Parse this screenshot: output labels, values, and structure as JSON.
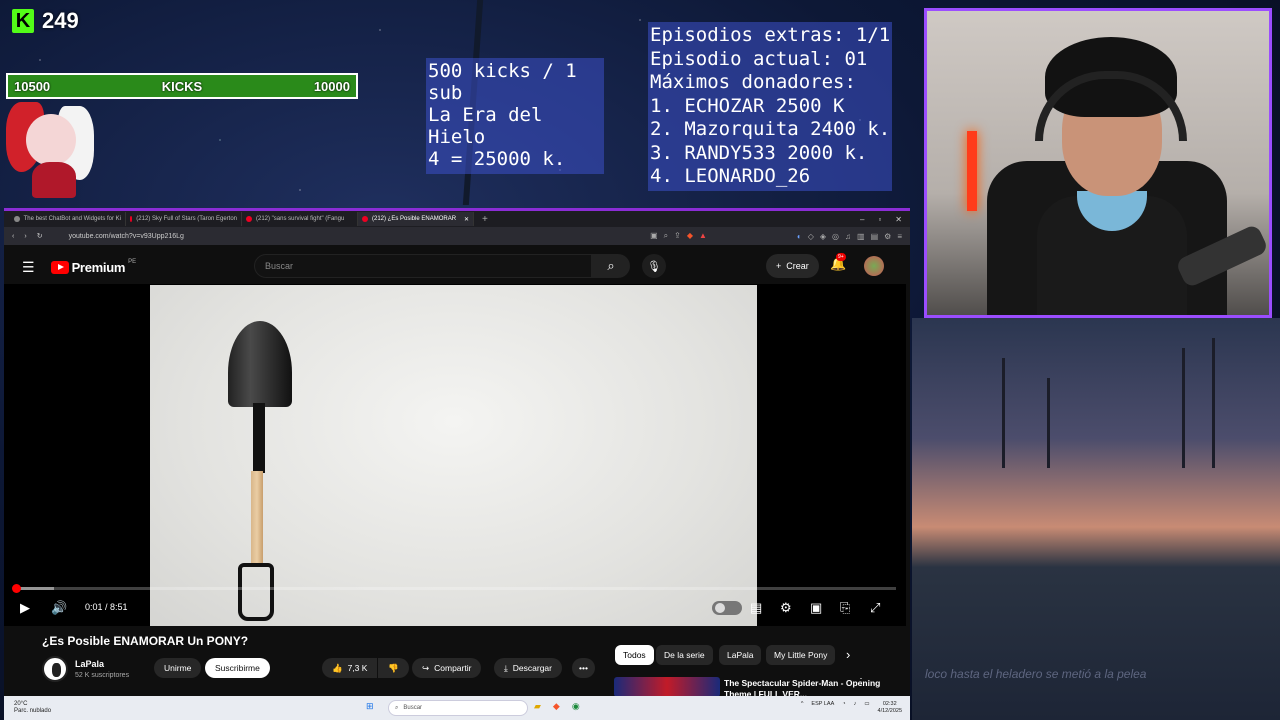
{
  "overlay": {
    "kick_count": "249",
    "kick_logo": "K",
    "kickbar": {
      "left": "10500",
      "label": "KICKS",
      "right": "10000"
    },
    "goal_lines": [
      "500 kicks / 1 sub",
      "La Era del Hielo",
      "4 = 25000 k."
    ],
    "info_lines": [
      "Episodios extras: 1/1",
      "Episodio actual: 01",
      "Máximos donadores:",
      "1. ECHOZAR 2500 K",
      "2. Mazorquita 2400 k.",
      "3. RANDY533 2000 k.",
      "4. LEONARDO_26"
    ],
    "chat_caption": "loco hasta el heladero se metió a la pelea"
  },
  "browser": {
    "tabs": [
      {
        "label": "The best ChatBot and Widgets for Ki",
        "active": false
      },
      {
        "label": "(212) Sky Full of Stars (Taron Egerton",
        "active": false
      },
      {
        "label": "(212) \"sans survival fight\" (Fangu",
        "active": false
      },
      {
        "label": "(212) ¿Es Posible ENAMORAR",
        "active": true
      }
    ],
    "url": "youtube.com/watch?v=v93Upp216Lg"
  },
  "youtube": {
    "logo_word": "Premium",
    "logo_region": "PE",
    "search_placeholder": "Buscar",
    "create_label": "Crear",
    "bell_badge": "9+",
    "player": {
      "time": "0:01 / 8:51",
      "progress_fraction": 0.002,
      "buffer_fraction": 0.045
    },
    "video_title": "¿Es Posible ENAMORAR Un PONY?",
    "channel_name": "LaPala",
    "channel_subs": "52 K suscriptores",
    "join_label": "Unirme",
    "subscribed_label": "Suscribirme",
    "likes": "7,3 K",
    "share_label": "Compartir",
    "download_label": "Descargar",
    "chips": [
      "Todos",
      "De la serie",
      "LaPala",
      "My Little Pony"
    ],
    "rec_title": "The Spectacular Spider-Man - Opening Theme | FULL VER..."
  },
  "taskbar": {
    "temp": "20°C",
    "weather": "Parc. nublado",
    "search": "Buscar",
    "lang": "ESP LAA",
    "time": "02:32",
    "date": "4/12/2025"
  },
  "colors": {
    "kick_green": "#53fc18",
    "yt_red": "#ff0000",
    "frame_purple": "#9b4dff"
  }
}
